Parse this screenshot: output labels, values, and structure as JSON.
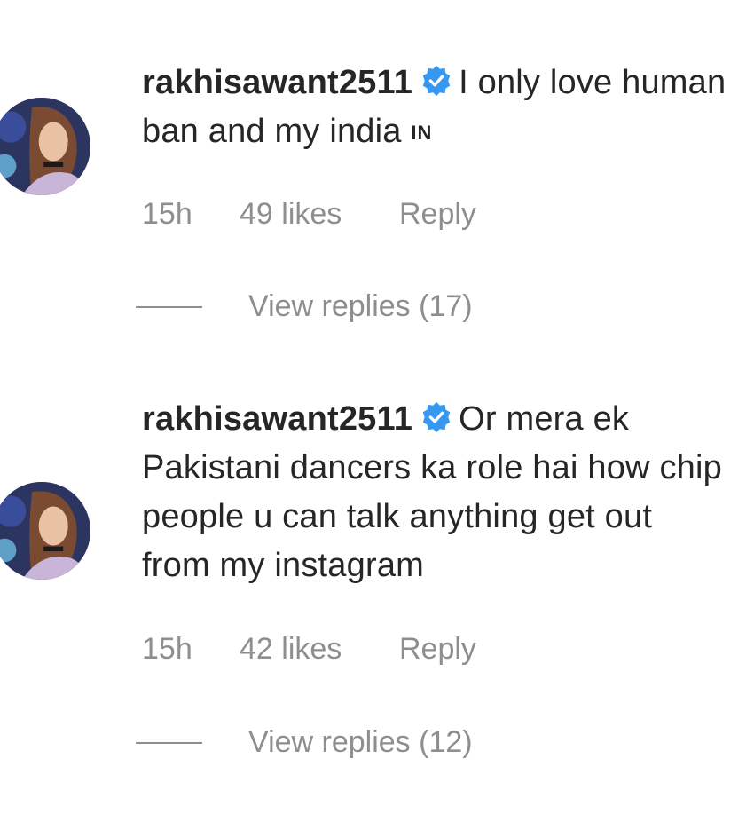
{
  "comments": [
    {
      "username": "rakhisawant2511",
      "text": "I only love human ban and my india",
      "flag": "IN",
      "time": "15h",
      "likes": "49 likes",
      "reply_label": "Reply",
      "view_replies": "View replies (17)"
    },
    {
      "username": "rakhisawant2511",
      "text": "Or mera ek Pakistani dancers ka role hai how chip people u can talk anything get out from my instagram",
      "time": "15h",
      "likes": "42 likes",
      "reply_label": "Reply",
      "view_replies": "View replies (12)"
    }
  ],
  "colors": {
    "text": "#262626",
    "muted": "#8e8e8e",
    "verified": "#3897f0"
  },
  "icons": {
    "verified": "verified-badge-icon"
  }
}
